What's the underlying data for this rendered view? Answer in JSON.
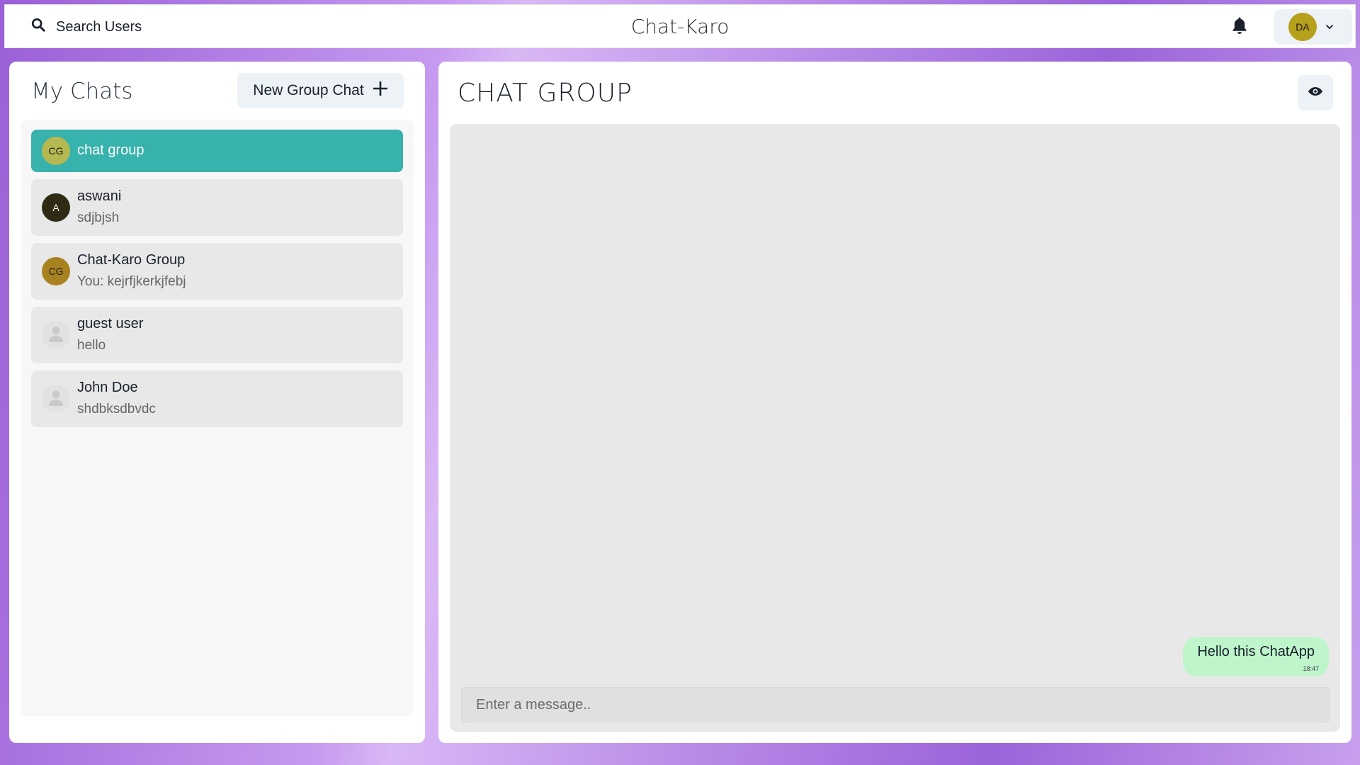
{
  "header": {
    "search_label": "Search Users",
    "app_title": "Chat-Karo",
    "profile_initials": "DA"
  },
  "sidebar": {
    "title": "My Chats",
    "new_group_label": "New Group Chat",
    "chats": [
      {
        "initials": "CG",
        "name": "chat group",
        "last_message": "",
        "avatar_color": "#b5b84e",
        "active": true
      },
      {
        "initials": "A",
        "name": "aswani",
        "last_message": "sdjbjsh",
        "avatar_color": "#2e2a14",
        "active": false
      },
      {
        "initials": "CG",
        "name": "Chat-Karo Group",
        "last_message": "You: kejrfjkerkjfebj",
        "avatar_color": "#a8821f",
        "active": false
      },
      {
        "initials": "",
        "name": "guest user",
        "last_message": "hello",
        "avatar_color": "#e2e2e2",
        "active": false
      },
      {
        "initials": "",
        "name": "John Doe",
        "last_message": "shdbksdbvdc",
        "avatar_color": "#e2e2e2",
        "active": false
      }
    ]
  },
  "chat": {
    "title": "CHAT GROUP",
    "messages": [
      {
        "text": "Hello this ChatApp",
        "time": "18:47",
        "own": true
      }
    ],
    "input_placeholder": "Enter a message.."
  },
  "colors": {
    "active_chat": "#38b2ac",
    "own_bubble": "#bef5cb"
  },
  "icons": [
    "search-icon",
    "bell-icon",
    "chevron-down-icon",
    "plus-icon",
    "eye-icon",
    "user-icon"
  ]
}
